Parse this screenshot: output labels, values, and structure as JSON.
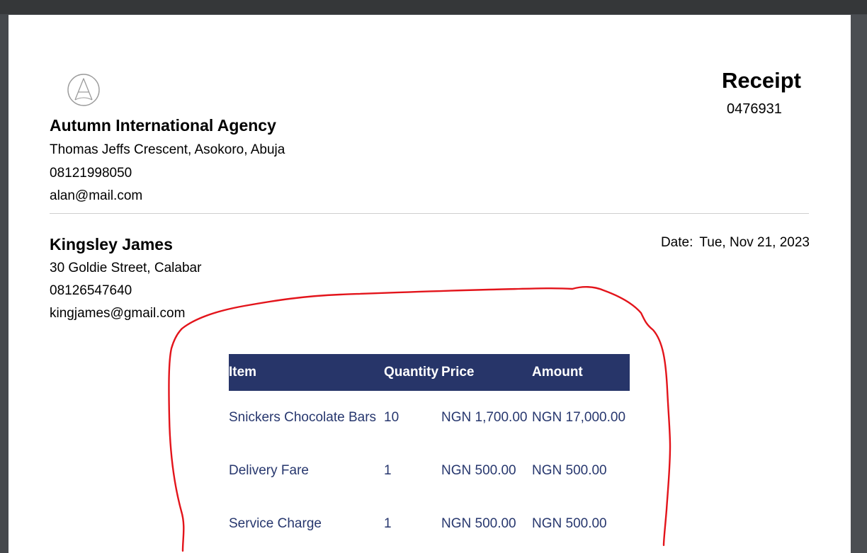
{
  "receipt": {
    "title": "Receipt",
    "number": "0476931"
  },
  "sender": {
    "name": "Autumn International Agency",
    "address": "Thomas Jeffs Crescent, Asokoro, Abuja",
    "phone": "08121998050",
    "email": "alan@mail.com"
  },
  "recipient": {
    "name": "Kingsley James",
    "address": "30 Goldie Street, Calabar",
    "phone": "08126547640",
    "email": "kingjames@gmail.com"
  },
  "date": {
    "label": "Date:",
    "value": "Tue, Nov 21, 2023"
  },
  "table": {
    "headers": [
      "Item",
      "Quantity",
      "Price",
      "Amount"
    ],
    "rows": [
      [
        "Snickers Chocolate Bars",
        "10",
        "NGN 1,700.00",
        "NGN 17,000.00"
      ],
      [
        "Delivery Fare",
        "1",
        "NGN 500.00",
        "NGN 500.00"
      ],
      [
        "Service Charge",
        "1",
        "NGN 500.00",
        "NGN 500.00"
      ]
    ]
  },
  "colors": {
    "header_bg": "#273569",
    "row_text": "#27376e",
    "annotation_stroke": "#e3141b"
  },
  "icons": {
    "logo": "letter-a-circle-logo"
  }
}
